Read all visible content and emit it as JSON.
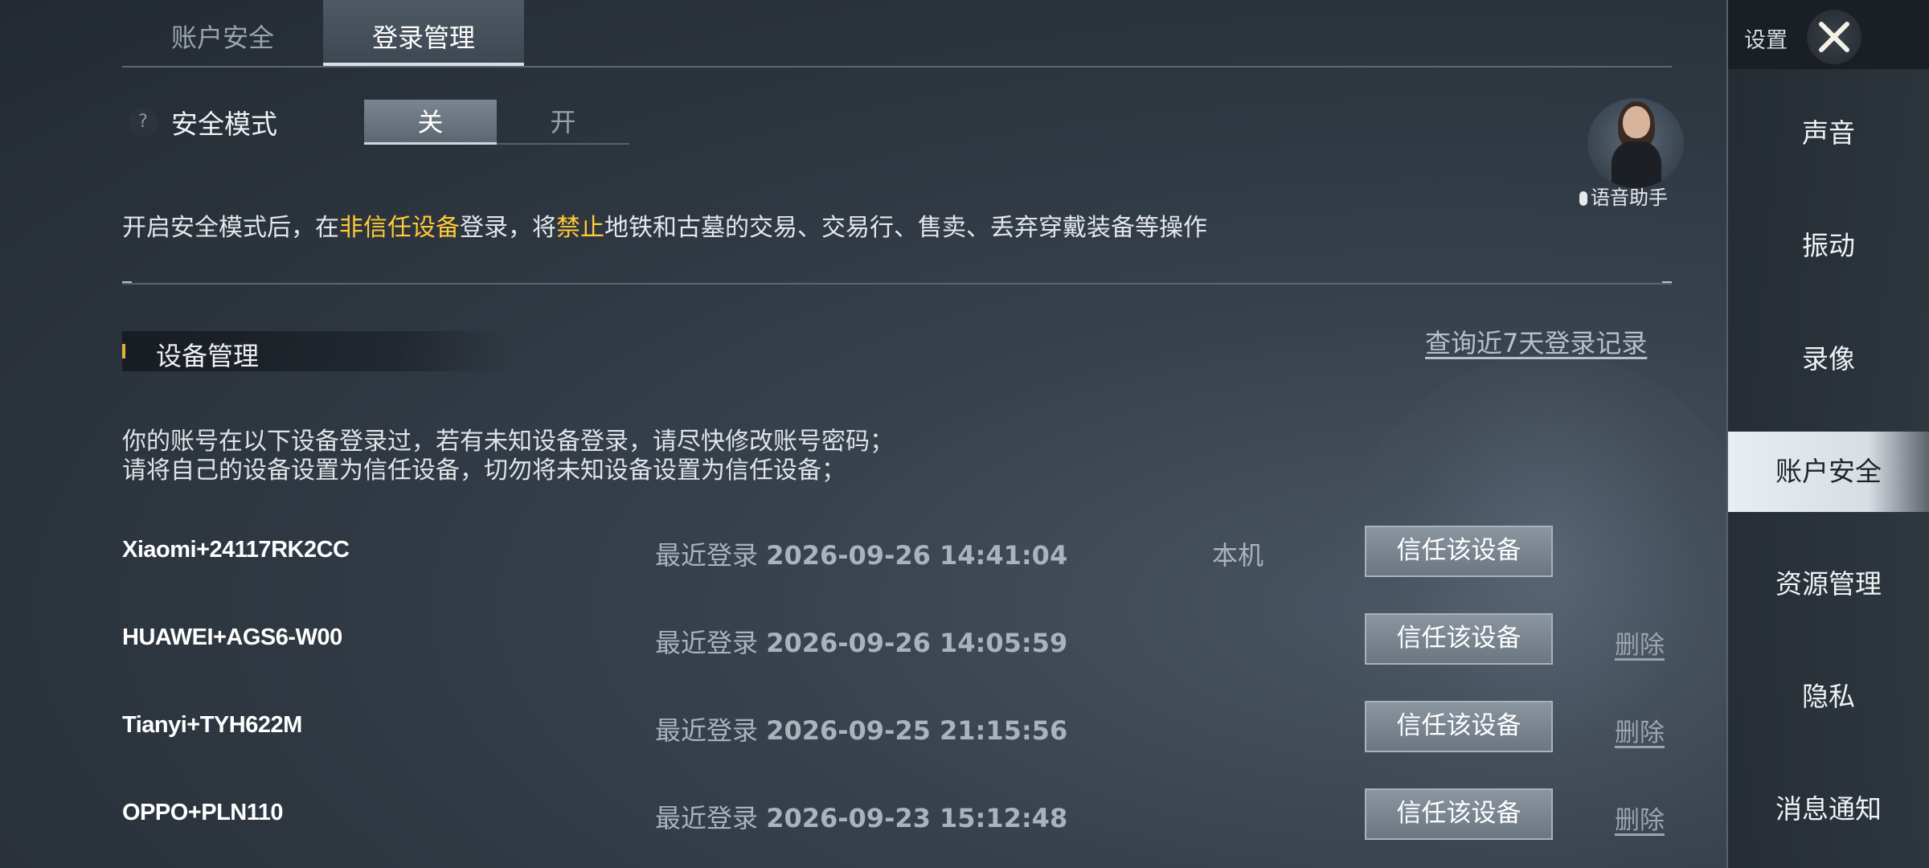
{
  "tabs": {
    "account_security": "账户安全",
    "login_management": "登录管理"
  },
  "safe_mode": {
    "help_icon": "?",
    "label": "安全模式",
    "off_label": "关",
    "on_label": "开",
    "selected": "关",
    "desc_part1": "开启安全模式后，在",
    "desc_highlight1": "非信任设备",
    "desc_part2": "登录，将",
    "desc_highlight2": "禁止",
    "desc_part3": "地铁和古墓的交易、交易行、售卖、丢弃穿戴装备等操作",
    "highlight_color": "#ffc93a"
  },
  "voice_assistant": {
    "label": "语音助手",
    "icon": "microphone-icon"
  },
  "device_management": {
    "title": "设备管理",
    "query_link": "查询近7天登录记录",
    "info_line1": "你的账号在以下设备登录过，若有未知设备登录，请尽快修改账号密码；",
    "info_line2": "请将自己的设备设置为信任设备，切勿将未知设备设置为信任设备；",
    "devices": [
      {
        "name": "Xiaomi+24117RK2CC",
        "time_prefix": "最近登录",
        "time": "2026-09-26 14:41:04",
        "local": "本机",
        "trust": "信任该设备",
        "delete": ""
      },
      {
        "name": "HUAWEI+AGS6-W00",
        "time_prefix": "最近登录",
        "time": "2026-09-26 14:05:59",
        "local": "",
        "trust": "信任该设备",
        "delete": "删除"
      },
      {
        "name": "Tianyi+TYH622M",
        "time_prefix": "最近登录",
        "time": "2026-09-25 21:15:56",
        "local": "",
        "trust": "信任该设备",
        "delete": "删除"
      },
      {
        "name": "OPPO+PLN110",
        "time_prefix": "最近登录",
        "time": "2026-09-23 15:12:48",
        "local": "",
        "trust": "信任该设备",
        "delete": "删除"
      }
    ]
  },
  "sidebar": {
    "title": "设置",
    "close_icon": "close-icon",
    "items": [
      {
        "label": "声音",
        "active": false
      },
      {
        "label": "振动",
        "active": false
      },
      {
        "label": "录像",
        "active": false
      },
      {
        "label": "账户安全",
        "active": true
      },
      {
        "label": "资源管理",
        "active": false
      },
      {
        "label": "隐私",
        "active": false
      },
      {
        "label": "消息通知",
        "active": false
      }
    ]
  }
}
